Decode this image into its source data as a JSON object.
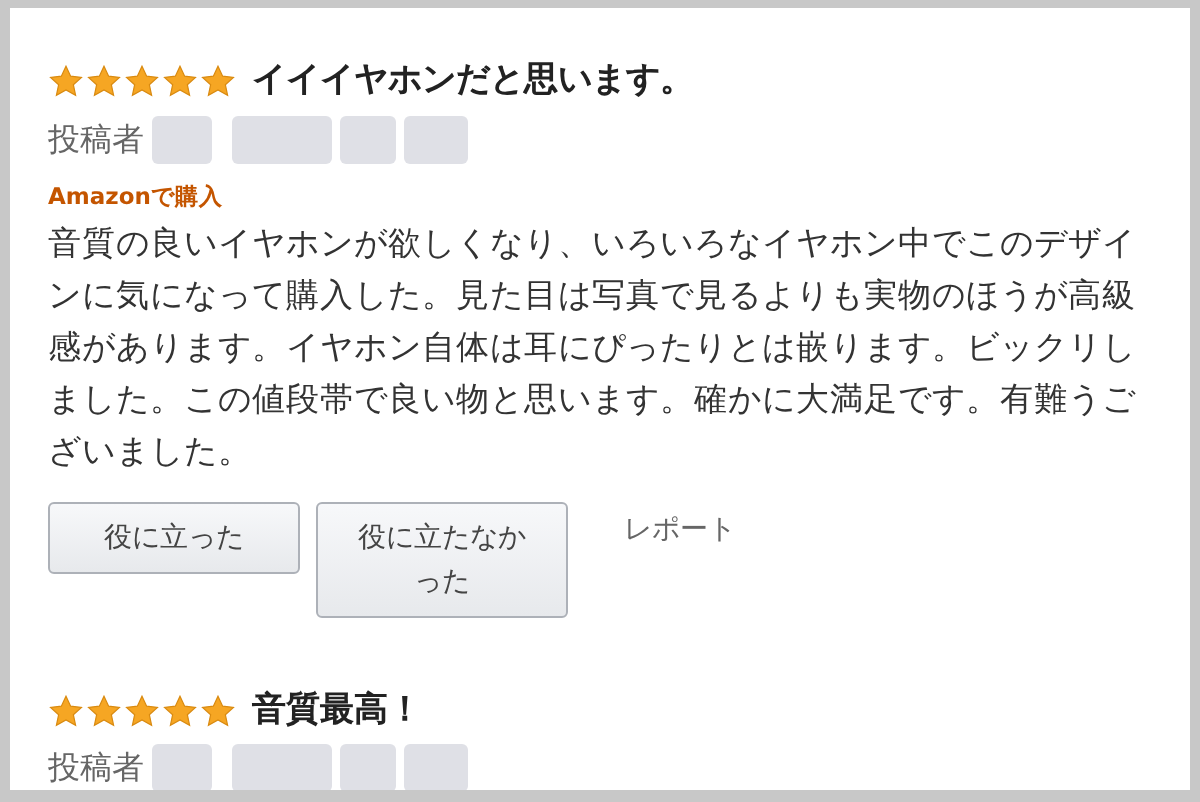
{
  "reviews": [
    {
      "stars": 5,
      "title": "イイイヤホンだと思います。",
      "author_label": "投稿者",
      "badge": "Amazonで購入",
      "body": "音質の良いイヤホンが欲しくなり、いろいろなイヤホン中でこのデザインに気になって購入した。見た目は写真で見るよりも実物のほうが高級感があります。イヤホン自体は耳にぴったりとは嵌ります。ビックリしました。この値段帯で良い物と思います。確かに大満足です。有難うございました。",
      "buttons": [
        "役に立った",
        "役に立たなかった"
      ],
      "report": "レポート"
    },
    {
      "stars": 5,
      "title": "音質最高！",
      "author_label": "投稿者"
    }
  ]
}
